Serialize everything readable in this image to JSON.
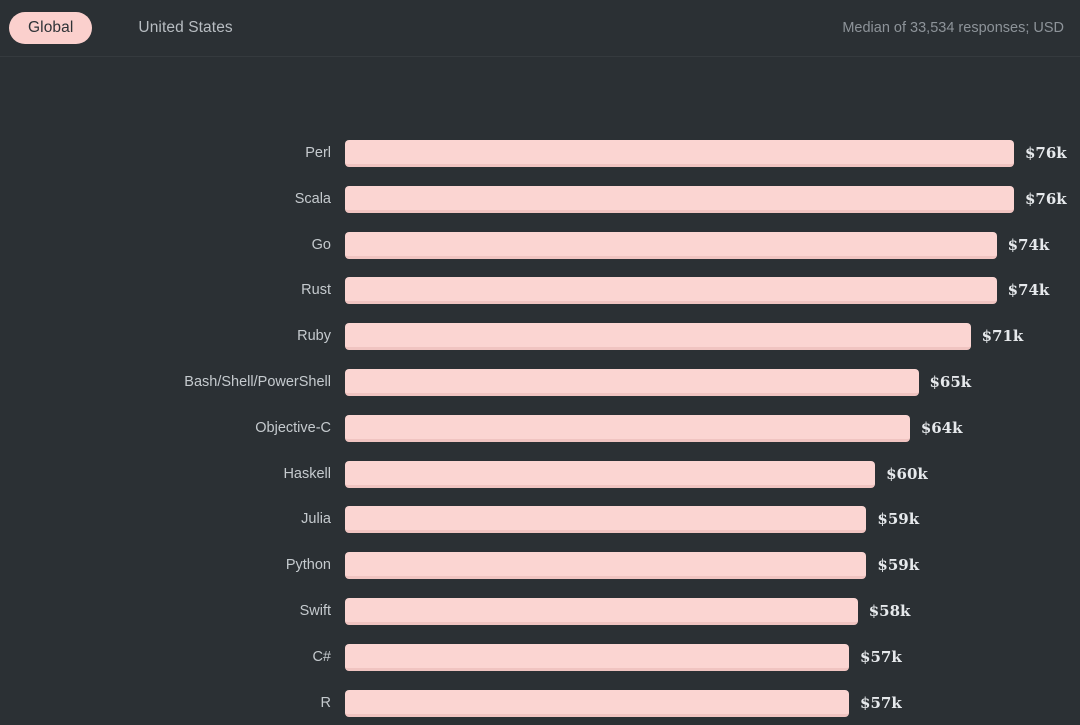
{
  "header": {
    "tabs": [
      {
        "label": "Global",
        "active": true
      },
      {
        "label": "United States",
        "active": false
      }
    ],
    "meta": "Median of 33,534 responses; USD"
  },
  "colors": {
    "background": "#2b3034",
    "bar": "#fbd5d2",
    "bar_shadow": "#f0c4c1",
    "accent_pill": "#fbd0cd",
    "label_text": "#c5cace",
    "value_text": "#e6e9ec",
    "meta_text": "#8d9399"
  },
  "chart_data": {
    "type": "bar",
    "orientation": "horizontal",
    "title": "",
    "subtitle": "Median of 33,534 responses; USD",
    "xlabel": "",
    "ylabel": "",
    "grid": false,
    "legend": false,
    "unit": "USD",
    "categories": [
      "Perl",
      "Scala",
      "Go",
      "Rust",
      "Ruby",
      "Bash/Shell/PowerShell",
      "Objective-C",
      "Haskell",
      "Julia",
      "Python",
      "Swift",
      "C#",
      "R"
    ],
    "values": [
      76,
      76,
      74,
      74,
      71,
      65,
      64,
      60,
      59,
      59,
      58,
      57,
      57
    ],
    "value_labels": [
      "$76k",
      "$76k",
      "$74k",
      "$74k",
      "$71k",
      "$65k",
      "$64k",
      "$60k",
      "$59k",
      "$59k",
      "$58k",
      "$57k",
      "$57k"
    ],
    "xlim": [
      0,
      76
    ]
  }
}
